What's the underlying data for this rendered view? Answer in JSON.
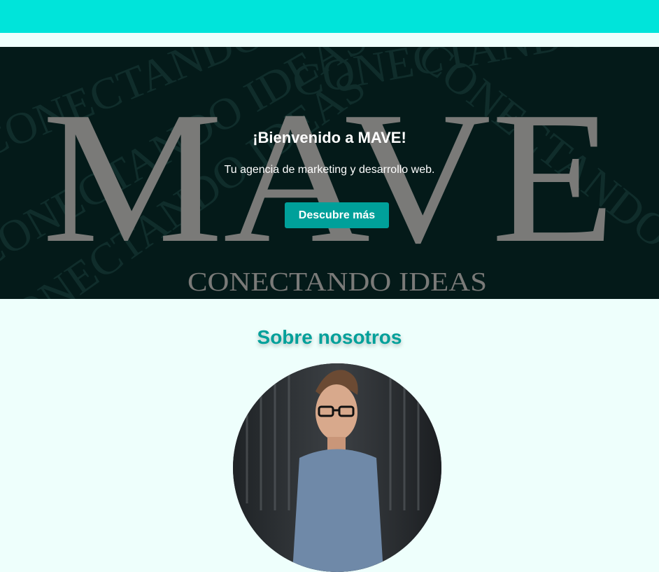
{
  "colors": {
    "topbar": "#00e4da",
    "hero_background": "#041a19",
    "accent": "#00a09a",
    "page_background": "#eefffc",
    "logo_gray": "#7a7a78"
  },
  "hero": {
    "logo_text": "MAVE",
    "logo_tagline": "CONECTANDO IDEAS",
    "background_pattern_text": "CONECTANDO IDEAS",
    "title": "¡Bienvenido a MAVE!",
    "subtitle": "Tu agencia de marketing y desarrollo web.",
    "cta_label": "Descubre más"
  },
  "about": {
    "title": "Sobre nosotros",
    "image_icon": "person-photo"
  }
}
